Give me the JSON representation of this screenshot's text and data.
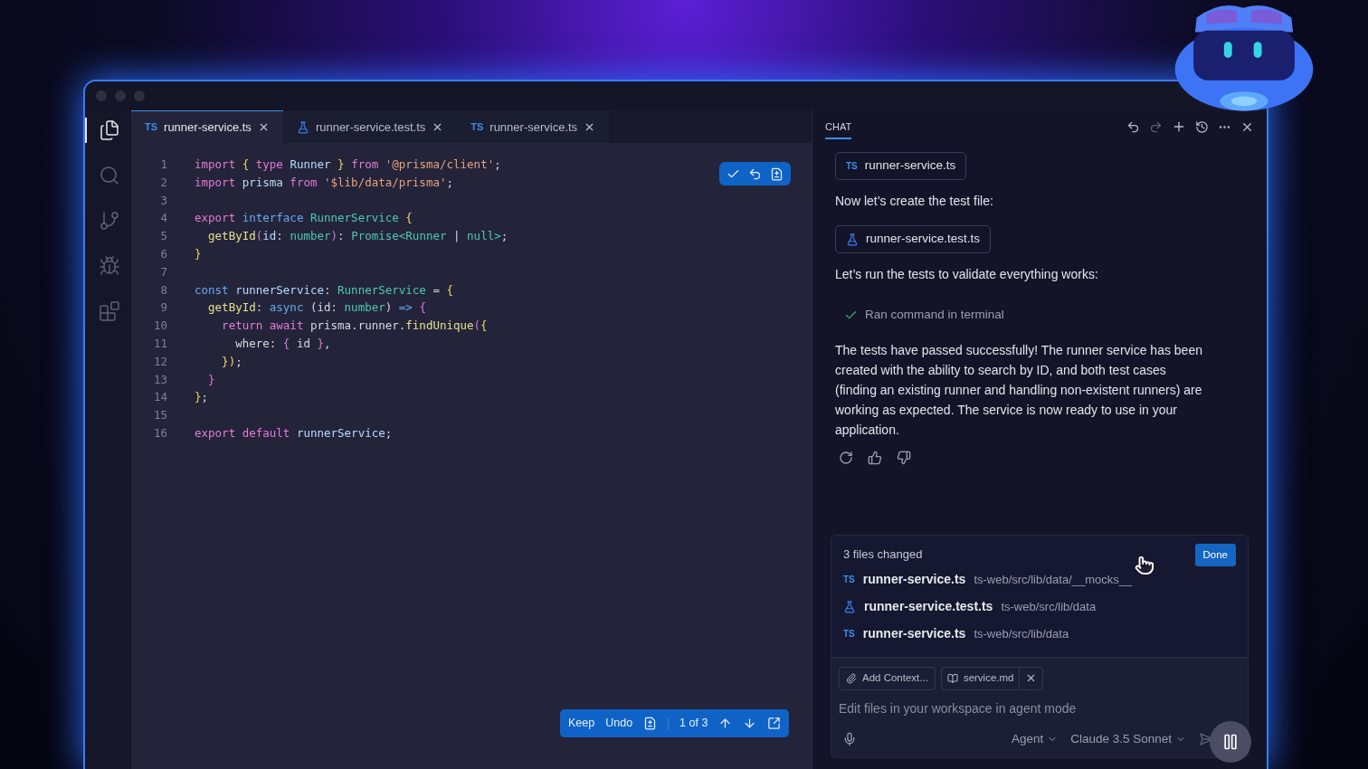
{
  "activity_bar": [
    {
      "selected": true
    },
    {
      "selected": false
    },
    {
      "selected": false
    },
    {
      "selected": false
    },
    {
      "selected": false
    }
  ],
  "tabs": [
    {
      "kind": "ts",
      "badge": "TS",
      "label": "runner-service.ts",
      "selected": true
    },
    {
      "kind": "test",
      "label": "runner-service.test.ts",
      "selected": false
    },
    {
      "kind": "ts",
      "badge": "TS",
      "label": "runner-service.ts",
      "selected": false
    }
  ],
  "editor": {
    "lines": [
      {
        "number": "1",
        "tokens": [
          {
            "kind": "kw",
            "text": "import"
          },
          {
            "kind": "brace",
            "text": " {"
          },
          {
            "kind": "kw",
            "text": " type"
          },
          {
            "kind": "var",
            "text": " Runner"
          },
          {
            "kind": "brace",
            "text": " }"
          },
          {
            "kind": "kw",
            "text": " from"
          },
          {
            "kind": "str",
            "text": " '@prisma/client'"
          },
          {
            "kind": "plain",
            "text": ";"
          }
        ]
      },
      {
        "number": "2",
        "tokens": [
          {
            "kind": "kw",
            "text": "import"
          },
          {
            "kind": "var",
            "text": " prisma"
          },
          {
            "kind": "kw",
            "text": " from"
          },
          {
            "kind": "str",
            "text": " '$lib/data/prisma'"
          },
          {
            "kind": "plain",
            "text": ";"
          }
        ]
      },
      {
        "number": "3"
      },
      {
        "number": "4",
        "tokens": [
          {
            "kind": "kw",
            "text": "export"
          },
          {
            "kind": "decl",
            "text": " interface"
          },
          {
            "kind": "type",
            "text": " RunnerService"
          },
          {
            "kind": "brace",
            "text": " {"
          }
        ]
      },
      {
        "number": "5",
        "tokens": [
          {
            "kind": "fn",
            "text": "  getById"
          },
          {
            "kind": "paren",
            "text": "("
          },
          {
            "kind": "var",
            "text": "id"
          },
          {
            "kind": "plain",
            "text": ": "
          },
          {
            "kind": "type",
            "text": "number"
          },
          {
            "kind": "paren",
            "text": ")"
          },
          {
            "kind": "plain",
            "text": ": "
          },
          {
            "kind": "type",
            "text": "Promise<Runner"
          },
          {
            "kind": "plain",
            "text": " | "
          },
          {
            "kind": "type",
            "text": "null>"
          },
          {
            "kind": "plain",
            "text": ";"
          }
        ]
      },
      {
        "number": "6",
        "tokens": [
          {
            "kind": "brace",
            "text": "}"
          }
        ]
      },
      {
        "number": "7"
      },
      {
        "number": "8",
        "tokens": [
          {
            "kind": "decl",
            "text": "const"
          },
          {
            "kind": "var",
            "text": " runnerService"
          },
          {
            "kind": "plain",
            "text": ": "
          },
          {
            "kind": "type",
            "text": "RunnerService"
          },
          {
            "kind": "plain",
            "text": " = "
          },
          {
            "kind": "brace",
            "text": "{"
          }
        ]
      },
      {
        "number": "9",
        "tokens": [
          {
            "kind": "fn",
            "text": "  getById"
          },
          {
            "kind": "plain",
            "text": ": "
          },
          {
            "kind": "decl",
            "text": "async"
          },
          {
            "kind": "plain",
            "text": " (id: "
          },
          {
            "kind": "type",
            "text": "number"
          },
          {
            "kind": "plain",
            "text": ") "
          },
          {
            "kind": "decl",
            "text": "=>"
          },
          {
            "kind": "paren",
            "text": " {"
          }
        ]
      },
      {
        "number": "10",
        "tokens": [
          {
            "kind": "kw",
            "text": "    return"
          },
          {
            "kind": "kw",
            "text": " await"
          },
          {
            "kind": "plain",
            "text": " prisma.runner."
          },
          {
            "kind": "fn",
            "text": "findUnique"
          },
          {
            "kind": "paren",
            "text": "("
          },
          {
            "kind": "brace",
            "text": "{"
          }
        ]
      },
      {
        "number": "11",
        "tokens": [
          {
            "kind": "plain",
            "text": "      where: "
          },
          {
            "kind": "paren",
            "text": "{"
          },
          {
            "kind": "plain",
            "text": " id "
          },
          {
            "kind": "paren",
            "text": "}"
          },
          {
            "kind": "plain",
            "text": ","
          }
        ]
      },
      {
        "number": "12",
        "tokens": [
          {
            "kind": "brace",
            "text": "    })"
          },
          {
            "kind": "plain",
            "text": ";"
          }
        ]
      },
      {
        "number": "13",
        "tokens": [
          {
            "kind": "paren",
            "text": "  }"
          }
        ]
      },
      {
        "number": "14",
        "tokens": [
          {
            "kind": "brace",
            "text": "}"
          },
          {
            "kind": "plain",
            "text": ";"
          }
        ]
      },
      {
        "number": "15"
      },
      {
        "number": "16",
        "tokens": [
          {
            "kind": "kw",
            "text": "export"
          },
          {
            "kind": "kw",
            "text": " default"
          },
          {
            "kind": "var",
            "text": " runnerService"
          },
          {
            "kind": "plain",
            "text": ";"
          }
        ]
      }
    ],
    "review_bar": {
      "keep": "Keep",
      "undo": "Undo",
      "counter": "1 of 3"
    }
  },
  "chat": {
    "tab": {
      "label": "CHAT",
      "selected": true
    },
    "messages": [
      {
        "kind": "file",
        "file": {
          "kind": "ts",
          "badge": "TS",
          "text": "runner-service.ts"
        }
      },
      {
        "kind": "text",
        "text": "Now let’s create the test file:"
      },
      {
        "kind": "file",
        "file": {
          "kind": "test",
          "text": "runner-service.test.ts"
        }
      },
      {
        "kind": "text",
        "text": "Let’s run the tests to validate everything works:"
      },
      {
        "kind": "tool",
        "text": "Ran command in terminal"
      },
      {
        "kind": "text",
        "text": "The tests have passed successfully! The runner service has been created with the ability to search by ID, and both test cases (finding an existing runner and handling non-existent runners) are working as expected. The service is now ready to use in your application."
      }
    ],
    "changes": {
      "title": "3 files changed",
      "done": "Done",
      "files": [
        {
          "kind": "ts",
          "badge": "TS",
          "name": "runner-service.ts",
          "path": "ts-web/src/lib/data/__mocks__"
        },
        {
          "kind": "test",
          "name": "runner-service.test.ts",
          "path": "ts-web/src/lib/data"
        },
        {
          "kind": "ts",
          "badge": "TS",
          "name": "runner-service.ts",
          "path": "ts-web/src/lib/data"
        }
      ]
    },
    "input": {
      "context_button": "Add Context...",
      "attachment": "service.md",
      "placeholder": "Edit files in your workspace in agent mode",
      "mode": "Agent",
      "model": "Claude 3.5 Sonnet"
    }
  }
}
